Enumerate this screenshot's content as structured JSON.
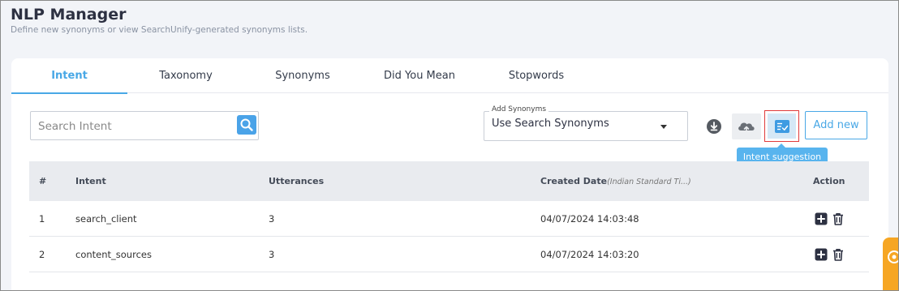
{
  "header": {
    "title": "NLP Manager",
    "subtitle": "Define new synonyms or view SearchUnify-generated synonyms lists."
  },
  "tabs": [
    {
      "label": "Intent",
      "active": true
    },
    {
      "label": "Taxonomy",
      "active": false
    },
    {
      "label": "Synonyms",
      "active": false
    },
    {
      "label": "Did You Mean",
      "active": false
    },
    {
      "label": "Stopwords",
      "active": false
    }
  ],
  "search": {
    "placeholder": "Search Intent",
    "value": "",
    "icon": "search-icon"
  },
  "synonyms_select": {
    "legend": "Add Synonyms",
    "value": "Use Search Synonyms",
    "icon": "chevron-down-icon"
  },
  "toolbar": {
    "download_icon": "download-icon",
    "upload_icon": "cloud-upload-icon",
    "suggest_icon": "intent-suggestion-icon",
    "add_new_label": "Add new",
    "tooltip": "Intent suggestion"
  },
  "table": {
    "columns": {
      "index": "#",
      "intent": "Intent",
      "utterances": "Utterances",
      "created": "Created Date",
      "created_tz": "(Indian Standard Ti...)",
      "action": "Action"
    },
    "rows": [
      {
        "index": "1",
        "intent": "search_client",
        "utterances": "3",
        "created": "04/07/2024 14:03:48"
      },
      {
        "index": "2",
        "intent": "content_sources",
        "utterances": "3",
        "created": "04/07/2024 14:03:20"
      }
    ]
  },
  "colors": {
    "accent": "#49a8e6",
    "highlight_border": "#e03b3b",
    "side_tab": "#f6a623"
  }
}
